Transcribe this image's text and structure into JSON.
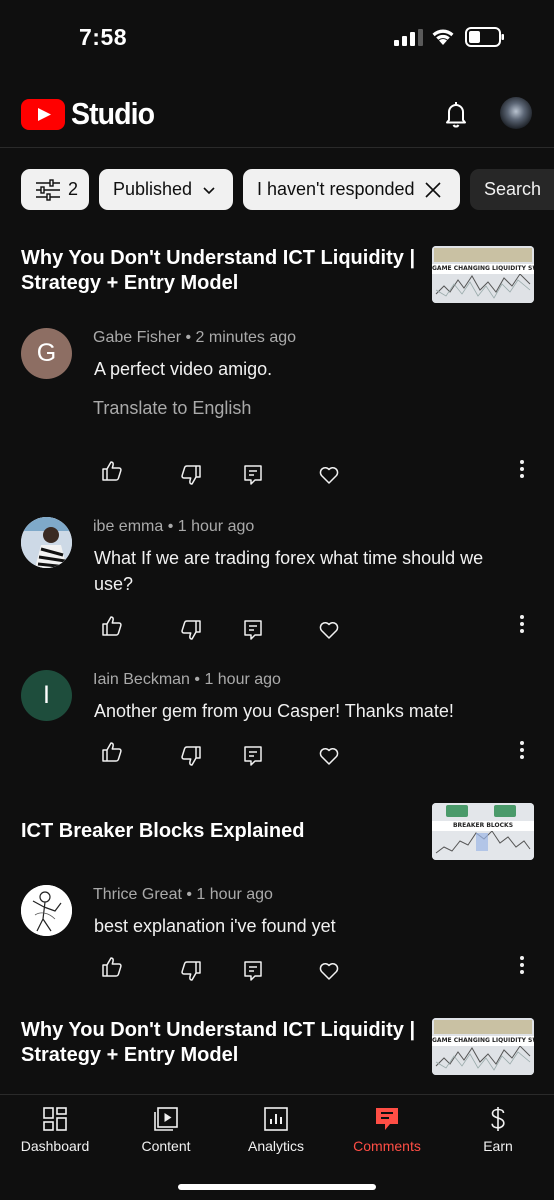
{
  "status_bar": {
    "time": "7:58"
  },
  "header": {
    "app_name": "Studio"
  },
  "filters": {
    "filter_count": "2",
    "published_label": "Published",
    "responded_label": "I haven't responded",
    "search_label": "Search"
  },
  "videos": [
    {
      "title": "Why You Don't Understand ICT Liquidity | Strategy + Entry Model",
      "thumb_text": "GAME CHANGING LIQUIDITY SWEEP STRATEGY",
      "comments": [
        {
          "author": "Gabe Fisher",
          "time": "2 minutes ago",
          "text": "A perfect video amigo.",
          "translate": "Translate to English",
          "avatar_letter": "G",
          "avatar_color": "#8d6e63"
        },
        {
          "author": "ibe emma",
          "time": "1 hour ago",
          "text": "What If we are trading forex what time should we use?"
        },
        {
          "author": "Iain Beckman",
          "time": "1 hour ago",
          "text": "Another gem from you Casper! Thanks mate!",
          "avatar_letter": "I",
          "avatar_color": "#1e4d3c"
        }
      ]
    },
    {
      "title": "ICT Breaker Blocks Explained",
      "thumb_text": "BREAKER BLOCKS",
      "comments": [
        {
          "author": "Thrice Great",
          "time": "1 hour ago",
          "text": "best explanation i've found yet"
        }
      ]
    },
    {
      "title": "Why You Don't Understand ICT Liquidity | Strategy + Entry Model",
      "thumb_text": "GAME CHANGING LIQUIDITY SWEEP STRATEGY"
    }
  ],
  "nav": [
    {
      "label": "Dashboard",
      "icon": "dashboard-icon"
    },
    {
      "label": "Content",
      "icon": "content-icon"
    },
    {
      "label": "Analytics",
      "icon": "analytics-icon"
    },
    {
      "label": "Comments",
      "icon": "comments-icon",
      "active": true
    },
    {
      "label": "Earn",
      "icon": "dollar-icon"
    }
  ],
  "colors": {
    "background": "#0f0f0f",
    "chip": "#f1f1f1",
    "brand_red": "#ff0000",
    "active_nav": "#ff4e45",
    "muted_text": "#aaaaaa"
  }
}
